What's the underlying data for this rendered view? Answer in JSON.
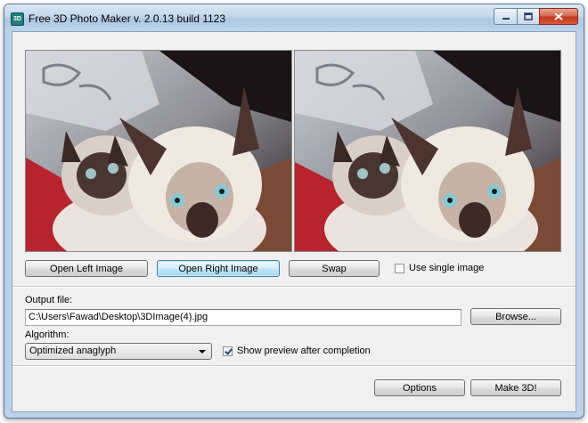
{
  "window": {
    "title": "Free 3D Photo Maker  v. 2.0.13 build 1123",
    "app_icon_text": "3D",
    "icons": [
      "minimize-icon",
      "maximize-icon",
      "close-icon"
    ]
  },
  "buttons": {
    "open_left": "Open Left Image",
    "open_right": "Open Right Image",
    "swap": "Swap",
    "browse": "Browse...",
    "options": "Options",
    "make_3d": "Make 3D!"
  },
  "use_single_image": {
    "label": "Use single image",
    "checked": false
  },
  "output": {
    "label": "Output file:",
    "value": "C:\\Users\\Fawad\\Desktop\\3DImage(4).jpg"
  },
  "algorithm": {
    "label": "Algorithm:",
    "selected": "Optimized anaglyph"
  },
  "show_preview": {
    "label": "Show preview after completion",
    "checked": true
  },
  "colors": {
    "titlebar": "#bcd2e8",
    "client_bg": "#f0f0f0",
    "close_button": "#c2391a",
    "focus_border": "#3c7fb1"
  }
}
